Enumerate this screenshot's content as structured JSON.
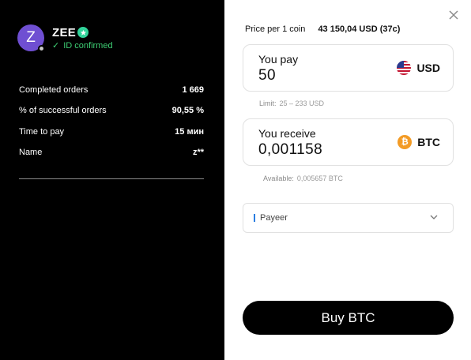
{
  "seller": {
    "avatar_letter": "Z",
    "name": "ZEE",
    "verified_icon": "verified-badge-icon",
    "confirmed_text": "ID confirmed"
  },
  "stats": [
    {
      "label": "Completed orders",
      "value": "1 669"
    },
    {
      "label": "% of successful orders",
      "value": "90,55 %"
    },
    {
      "label": "Time to pay",
      "value": "15 мин"
    },
    {
      "label": "Name",
      "value": "z**"
    }
  ],
  "price": {
    "label": "Price per 1 coin",
    "value": "43 150,04 USD (37c)"
  },
  "pay": {
    "label": "You pay",
    "amount": "50",
    "currency": "USD",
    "limit_label": "Limit:",
    "limit_value": "25 – 233 USD"
  },
  "receive": {
    "label": "You receive",
    "amount": "0,001158",
    "currency": "BTC",
    "btc_symbol": "₿",
    "available_label": "Available:",
    "available_value": "0,005657 BTC"
  },
  "payment_method": {
    "selected": "Payeer"
  },
  "buy_button": {
    "label": "Buy BTC"
  },
  "colors": {
    "accent_green": "#3ecf74",
    "avatar_purple": "#6f4fd2",
    "btc_orange": "#f39b25"
  }
}
